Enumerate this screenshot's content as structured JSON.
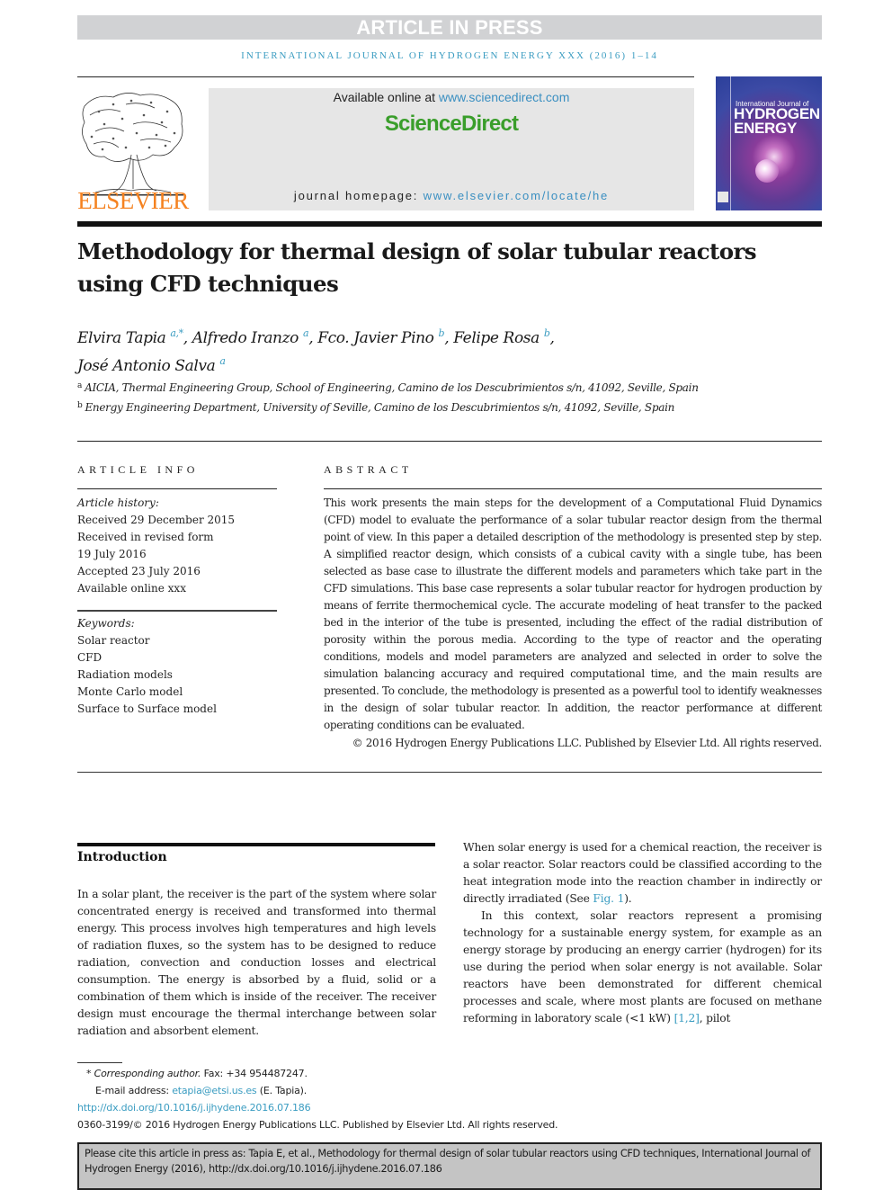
{
  "banner": {
    "text": "ARTICLE IN PRESS"
  },
  "journal_line": "INTERNATIONAL JOURNAL OF HYDROGEN ENERGY XXX (2016) 1–14",
  "publisher": {
    "wordmark": "ELSEVIER",
    "brand_color": "#f58220"
  },
  "sciencedirect": {
    "available_prefix": "Available online at ",
    "available_link": "www.sciencedirect.com",
    "wordmark": "ScienceDirect",
    "wordmark_color": "#3a9e2b",
    "homepage_prefix": "journal homepage: ",
    "homepage_link": "www.elsevier.com/locate/he",
    "link_color": "#3a8fc1"
  },
  "cover": {
    "small_title": "International Journal of",
    "big_title_1": "HYDROGEN",
    "big_title_2": "ENERGY"
  },
  "article": {
    "title": "Methodology for thermal design of solar tubular reactors using CFD techniques",
    "authors": [
      {
        "name": "Elvira Tapia",
        "aff": "a,*",
        "sep": ", "
      },
      {
        "name": "Alfredo Iranzo",
        "aff": "a",
        "sep": ", "
      },
      {
        "name": "Fco. Javier Pino",
        "aff": "b",
        "sep": ", "
      },
      {
        "name": "Felipe Rosa",
        "aff": "b",
        "sep": ","
      },
      {
        "name": "José Antonio Salva",
        "aff": "a",
        "sep": ""
      }
    ],
    "affiliations": [
      {
        "mark": "a",
        "text": "AICIA, Thermal Engineering Group, School of Engineering, Camino de los Descubrimientos s/n, 41092, Seville, Spain"
      },
      {
        "mark": "b",
        "text": "Energy Engineering Department, University of Seville, Camino de los Descubrimientos s/n, 41092, Seville, Spain"
      }
    ]
  },
  "article_info": {
    "label": "ARTICLE INFO",
    "history_head": "Article history:",
    "history": [
      "Received 29 December 2015",
      "Received in revised form",
      "19 July 2016",
      "Accepted 23 July 2016",
      "Available online xxx"
    ],
    "keywords_head": "Keywords:",
    "keywords": [
      "Solar reactor",
      "CFD",
      "Radiation models",
      "Monte Carlo model",
      "Surface to Surface model"
    ]
  },
  "abstract": {
    "label": "ABSTRACT",
    "text": "This work presents the main steps for the development of a Computational Fluid Dynamics (CFD) model to evaluate the performance of a solar tubular reactor design from the thermal point of view. In this paper a detailed description of the methodology is presented step by step. A simplified reactor design, which consists of a cubical cavity with a single tube, has been selected as base case to illustrate the different models and parameters which take part in the CFD simulations. This base case represents a solar tubular reactor for hydrogen production by means of ferrite thermochemical cycle. The accurate modeling of heat transfer to the packed bed in the interior of the tube is presented, including the effect of the radial distribution of porosity within the porous media. According to the type of reactor and the operating conditions, models and model parameters are analyzed and selected in order to solve the simulation balancing accuracy and required computational time, and the main results are presented. To conclude, the methodology is presented as a powerful tool to identify weaknesses in the design of solar tubular reactor. In addition, the reactor performance at different operating conditions can be evaluated.",
    "copyright": "© 2016 Hydrogen Energy Publications LLC. Published by Elsevier Ltd. All rights reserved."
  },
  "introduction": {
    "heading": "Introduction",
    "left_paragraph": "In a solar plant, the receiver is the part of the system where solar concentrated energy is received and transformed into thermal energy. This process involves high temperatures and high levels of radiation fluxes, so the system has to be designed to reduce radiation, convection and conduction losses and electrical consumption. The energy is absorbed by a fluid, solid or a combination of them which is inside of the receiver. The receiver design must encourage the thermal interchange between solar radiation and absorbent element.",
    "right_p1_before": "When solar energy is used for a chemical reaction, the receiver is a solar reactor. Solar reactors could be classified according to the heat integration mode into the reaction chamber in indirectly or directly irradiated (See ",
    "right_p1_link": "Fig. 1",
    "right_p1_after": ").",
    "right_p2_before": "In this context, solar reactors represent a promising technology for a sustainable energy system, for example as an energy storage by producing an energy carrier (hydrogen) for its use during the period when solar energy is not available. Solar reactors have been demonstrated for different chemical processes and scale, where most plants are focused on methane reforming in laboratory scale (<1 kW) ",
    "right_p2_link": "[1,2]",
    "right_p2_after": ", pilot"
  },
  "footnotes": {
    "corresponding_label": "Corresponding author.",
    "corresponding_fax": " Fax: +34 954487247.",
    "email_label": "E-mail address: ",
    "email": "etapia@etsi.us.es",
    "email_after": " (E. Tapia).",
    "doi": "http://dx.doi.org/10.1016/j.ijhydene.2016.07.186",
    "issn_line": "0360-3199/© 2016 Hydrogen Energy Publications LLC. Published by Elsevier Ltd. All rights reserved."
  },
  "citation_box": {
    "text": "Please cite this article in press as: Tapia E, et al., Methodology for thermal design of solar tubular reactors using CFD techniques, International Journal of Hydrogen Energy (2016), http://dx.doi.org/10.1016/j.ijhydene.2016.07.186"
  }
}
